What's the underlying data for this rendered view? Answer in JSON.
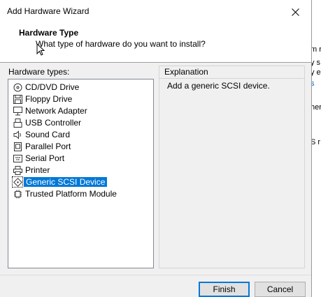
{
  "window": {
    "title": "Add Hardware Wizard",
    "close_icon": "close-icon"
  },
  "header": {
    "title": "Hardware Type",
    "subtitle": "What type of hardware do you want to install?"
  },
  "hardware_types": {
    "label": "Hardware types:",
    "items": [
      {
        "label": "CD/DVD Drive",
        "icon": "cd-drive-icon"
      },
      {
        "label": "Floppy Drive",
        "icon": "floppy-drive-icon"
      },
      {
        "label": "Network Adapter",
        "icon": "network-adapter-icon"
      },
      {
        "label": "USB Controller",
        "icon": "usb-icon"
      },
      {
        "label": "Sound Card",
        "icon": "speaker-icon"
      },
      {
        "label": "Parallel Port",
        "icon": "parallel-port-icon"
      },
      {
        "label": "Serial Port",
        "icon": "serial-port-icon"
      },
      {
        "label": "Printer",
        "icon": "printer-icon"
      },
      {
        "label": "Generic SCSI Device",
        "icon": "scsi-icon",
        "selected": true
      },
      {
        "label": "Trusted Platform Module",
        "icon": "tpm-icon"
      }
    ]
  },
  "explanation": {
    "label": "Explanation",
    "text": "Add a generic SCSI device."
  },
  "buttons": {
    "finish": "Finish",
    "cancel": "Cancel"
  },
  "background_fragments": [
    "m r",
    "y s",
    "y e",
    "s",
    "her",
    "S r"
  ],
  "colors": {
    "selection": "#0078d7",
    "dialog_bg": "#f0f0f0",
    "link": "#0066cc"
  }
}
